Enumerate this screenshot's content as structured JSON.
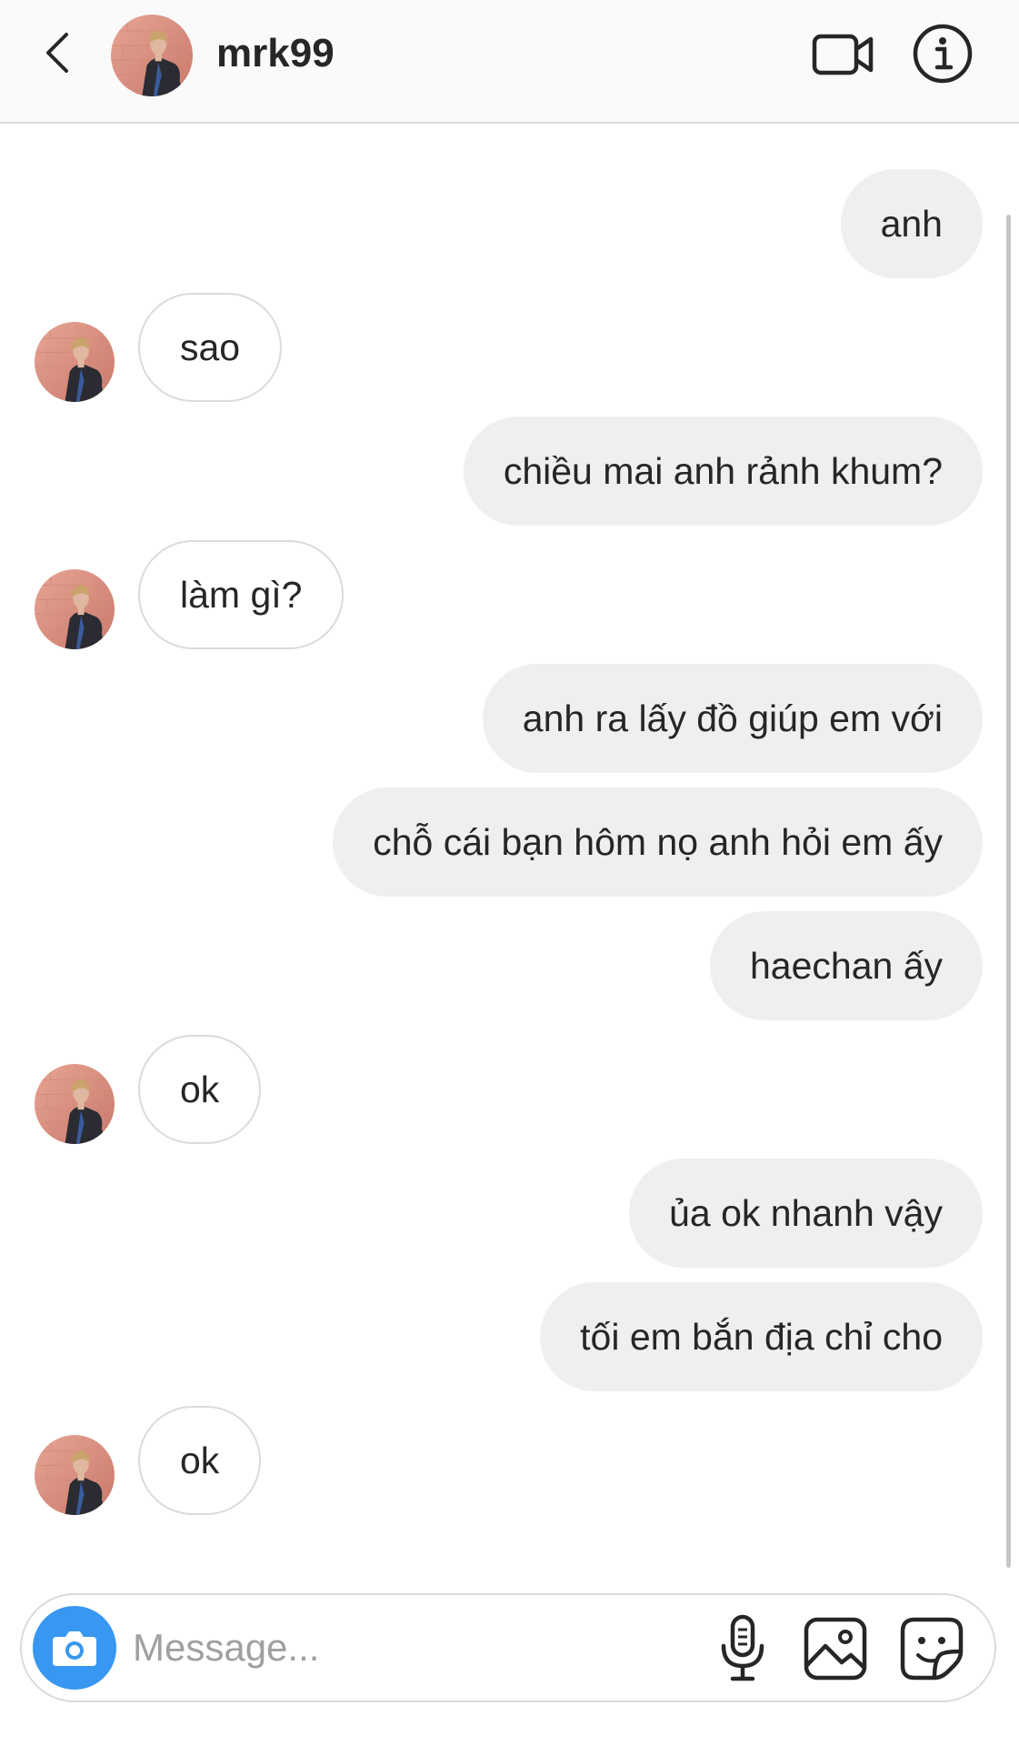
{
  "header": {
    "username": "mrk99",
    "back_icon": "chevron-left-icon",
    "video_icon": "video-camera-icon",
    "info_icon": "info-icon"
  },
  "conversation": {
    "messages": [
      {
        "side": "out",
        "text": "anh"
      },
      {
        "side": "in",
        "text": "sao"
      },
      {
        "side": "out",
        "text": "chiều mai anh rảnh khum?"
      },
      {
        "side": "in",
        "text": "làm gì?"
      },
      {
        "side": "out",
        "text": "anh ra lấy đồ giúp em với"
      },
      {
        "side": "out",
        "text": "chỗ cái bạn hôm nọ anh hỏi em ấy"
      },
      {
        "side": "out",
        "text": "haechan ấy"
      },
      {
        "side": "in",
        "text": "ok"
      },
      {
        "side": "out",
        "text": "ủa ok nhanh vậy"
      },
      {
        "side": "out",
        "text": "tối em bắn địa chỉ cho"
      },
      {
        "side": "in",
        "text": "ok"
      }
    ]
  },
  "composer": {
    "placeholder": "Message...",
    "value": "",
    "camera_icon": "camera-icon",
    "mic_icon": "microphone-icon",
    "gallery_icon": "image-icon",
    "sticker_icon": "sticker-icon"
  },
  "colors": {
    "accent": "#3897f0",
    "outgoing_bubble": "#efefef",
    "incoming_border": "#dbdbdb"
  }
}
